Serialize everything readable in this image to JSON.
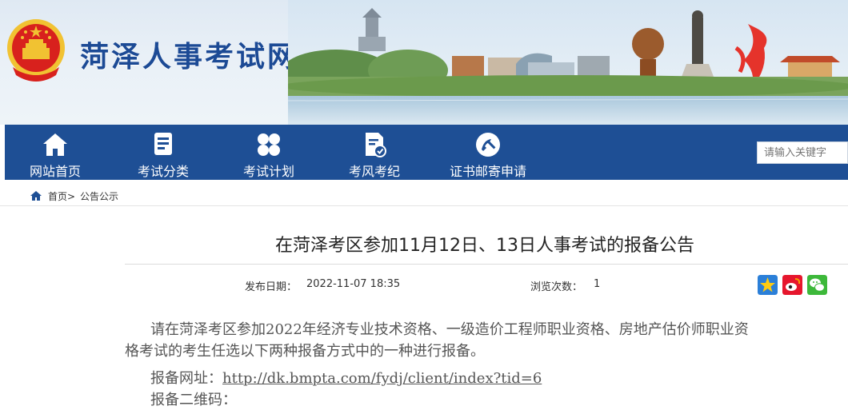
{
  "site": {
    "title": "菏泽人事考试网"
  },
  "nav": {
    "items": [
      {
        "label": "网站首页",
        "icon": "home-icon"
      },
      {
        "label": "考试分类",
        "icon": "document-list-icon"
      },
      {
        "label": "考试计划",
        "icon": "grid-icon"
      },
      {
        "label": "考风考纪",
        "icon": "document-check-icon"
      },
      {
        "label": "证书邮寄申请",
        "icon": "party-emblem-icon"
      }
    ],
    "search_placeholder": "请输入关键字"
  },
  "breadcrumb": {
    "home": "首页>",
    "current": "公告公示"
  },
  "article": {
    "title": "在菏泽考区参加11月12日、13日人事考试的报备公告",
    "publish_label": "发布日期：",
    "publish_date": "2022-11-07 18:35",
    "views_label": "浏览次数：",
    "views": "1",
    "share_icons": [
      "qzone-star-icon",
      "weibo-icon",
      "wechat-icon"
    ],
    "para1_line1": "请在菏泽考区参加2022年经济专业技术资格、一级造价工程师职业资格、房地产估价师职业资",
    "para1_line2": "格考试的考生任选以下两种报备方式中的一种进行报备。",
    "url_label": "报备网址：",
    "url": "http://dk.bmpta.com/fydj/client/index?tid=6",
    "qr_label": "报备二维码："
  },
  "colors": {
    "nav_bg": "#1e4f95",
    "title_blue": "#1c4a95",
    "emblem_red": "#d8211d",
    "emblem_gold": "#f1c232"
  }
}
